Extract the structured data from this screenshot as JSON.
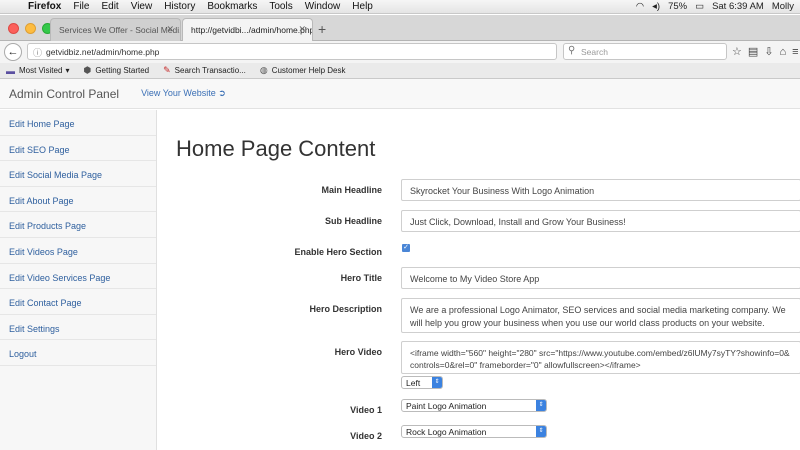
{
  "menubar": {
    "app": "Firefox",
    "items": [
      "File",
      "Edit",
      "View",
      "History",
      "Bookmarks",
      "Tools",
      "Window",
      "Help"
    ],
    "battery": "75%",
    "clock": "Sat 6:39 AM",
    "user": "Molly"
  },
  "tabs": [
    {
      "title": "Services We Offer - Social Medi..."
    },
    {
      "title": "http://getvidbi.../admin/home.php"
    }
  ],
  "nav": {
    "url": "getvidbiz.net/admin/home.php",
    "search_placeholder": "Search"
  },
  "bookmarks": [
    "Most Visited",
    "Getting Started",
    "Search Transactio...",
    "Customer Help Desk"
  ],
  "admin": {
    "brand": "Admin Control Panel",
    "view_site": "View Your Website"
  },
  "sidebar": {
    "items": [
      {
        "label": "Edit Home Page"
      },
      {
        "label": "Edit SEO Page"
      },
      {
        "label": "Edit Social Media Page"
      },
      {
        "label": "Edit About Page"
      },
      {
        "label": "Edit Products Page"
      },
      {
        "label": "Edit Videos Page"
      },
      {
        "label": "Edit Video Services Page"
      },
      {
        "label": "Edit Contact Page"
      },
      {
        "label": "Edit Settings"
      },
      {
        "label": "Logout"
      }
    ]
  },
  "form": {
    "title": "Home Page Content",
    "main_headline": {
      "label": "Main Headline",
      "value": "Skyrocket Your Business With Logo Animation"
    },
    "sub_headline": {
      "label": "Sub Headline",
      "value": "Just Click, Download, Install and Grow Your Business!"
    },
    "enable_hero": {
      "label": "Enable Hero Section",
      "checked": true
    },
    "hero_title": {
      "label": "Hero Title",
      "value": "Welcome to My Video Store App"
    },
    "hero_description": {
      "label": "Hero Description",
      "value": "We are a professional Logo Animator, SEO services and social media marketing company. We will help you grow your business when you use our world class products on your website."
    },
    "hero_video": {
      "label": "Hero Video",
      "value": "<iframe width=\"560\" height=\"280\" src=\"https://www.youtube.com/embed/z6lUMy7syTY?showinfo=0&controls=0&rel=0\" frameborder=\"0\" allowfullscreen></iframe>",
      "align": "Left"
    },
    "video1": {
      "label": "Video 1",
      "value": "Paint Logo Animation"
    },
    "video2": {
      "label": "Video 2",
      "value": "Rock Logo Animation"
    }
  }
}
